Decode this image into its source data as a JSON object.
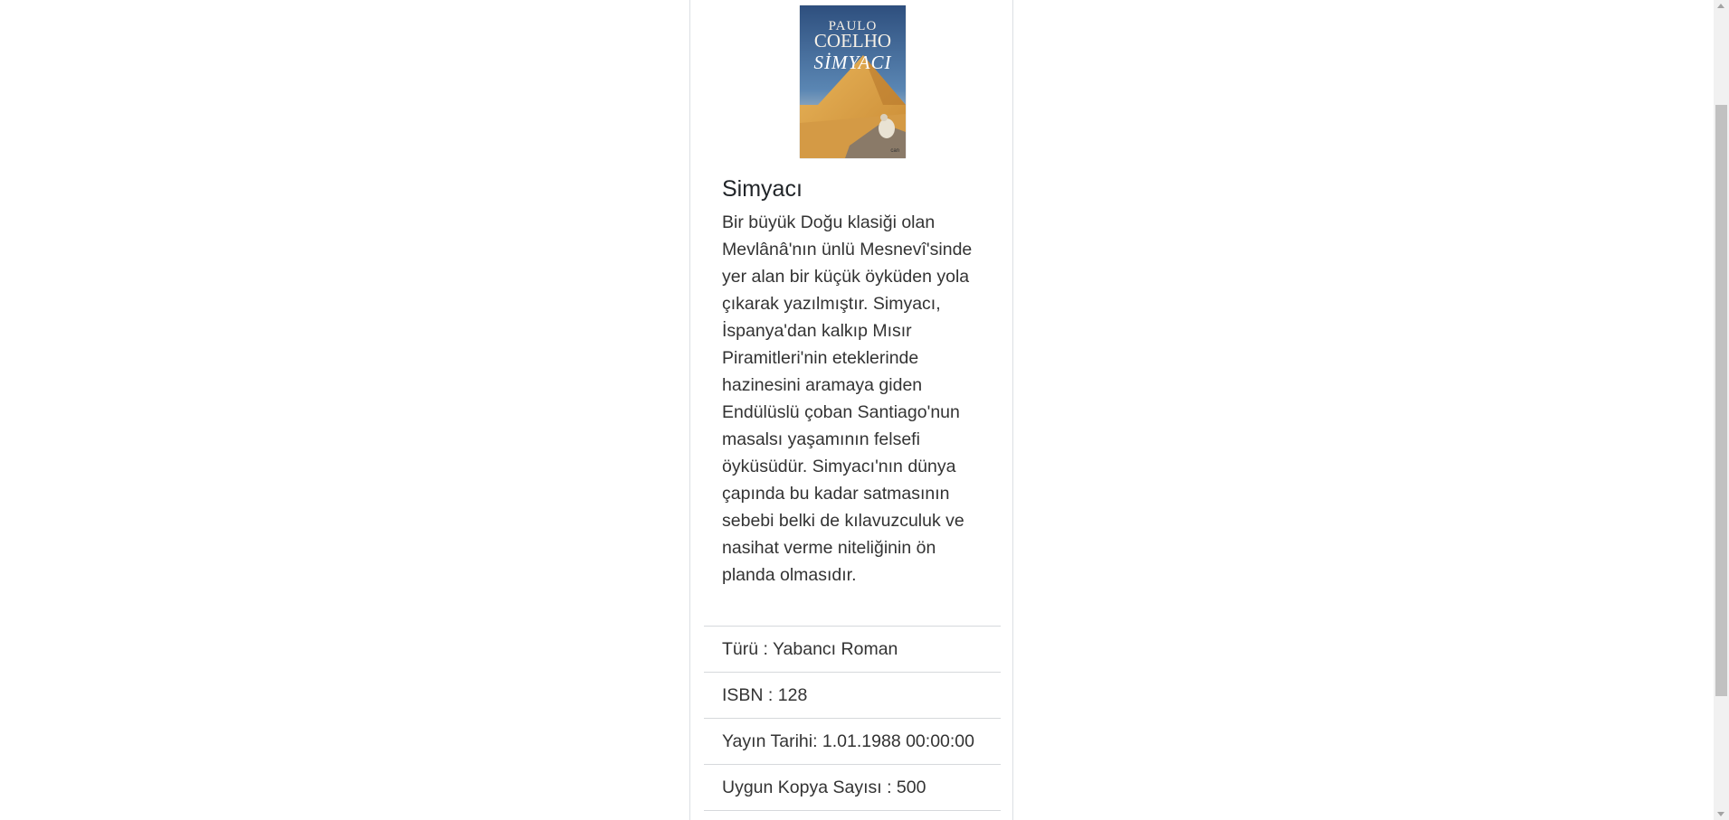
{
  "book": {
    "cover": {
      "author_line1": "PAULO",
      "author_line2": "COELHO",
      "title": "SİMYACI",
      "publisher": "can"
    },
    "title": "Simyacı",
    "description": "Bir büyük Doğu klasiği olan Mevlânâ'nın ünlü Mesnevî'sinde yer alan bir küçük öyküden yola çıkarak yazılmıştır. Simyacı, İspanya'dan kalkıp Mısır Piramitleri'nin eteklerinde hazinesini aramaya giden Endülüslü çoban Santiago'nun masalsı yaşamının felsefi öyküsüdür. Simyacı'nın dünya çapında bu kadar satmasının sebebi belki de kılavuzculuk ve nasihat verme niteliğinin ön planda olmasıdır.",
    "details": [
      "Türü : Yabancı Roman",
      "ISBN : 128",
      "Yayın Tarihi: 1.01.1988 00:00:00",
      "Uygun Kopya Sayısı : 500"
    ]
  }
}
